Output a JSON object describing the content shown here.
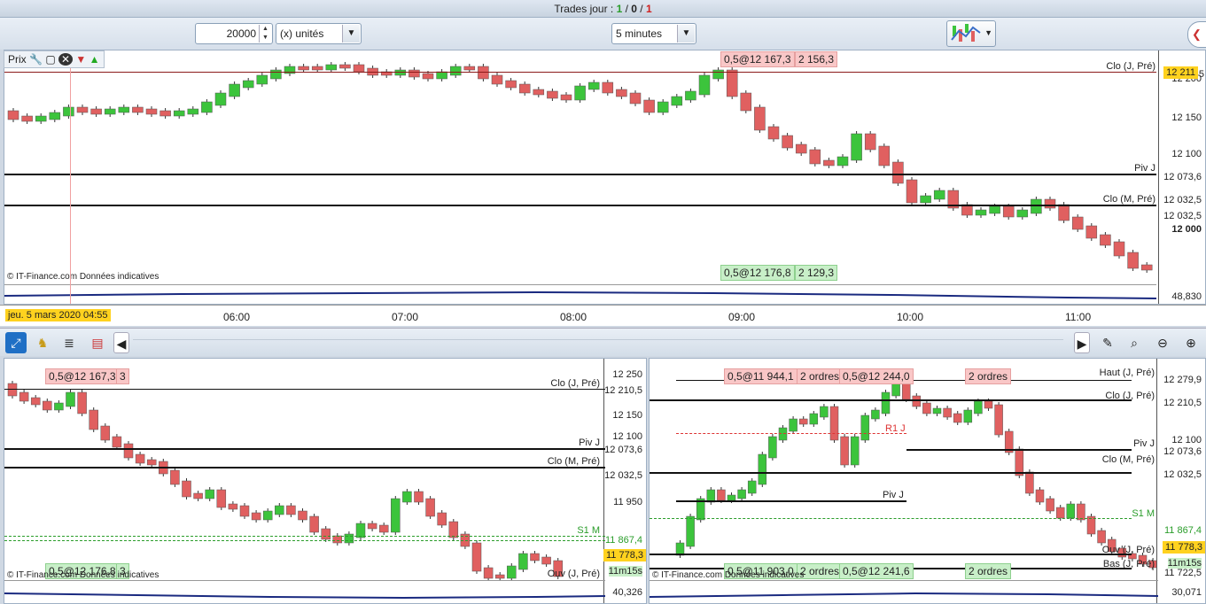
{
  "titlebar": {
    "prefix": "Trades jour : ",
    "win": "1",
    "sep1": " / ",
    "neutral": "0",
    "sep2": " / ",
    "loss": "1"
  },
  "toolbar": {
    "quantity": "20000",
    "units": "(x) unités",
    "timeframe": "5 minutes"
  },
  "main": {
    "indicator": "Prix",
    "copyright": "© IT-Finance.com  Données indicatives",
    "order_top": "0,5@12 167,3",
    "order_top2": "2 156,3",
    "order_bottom": "0,5@12 176,8",
    "order_bottom2": "2 129,3",
    "line_labels": {
      "clo_j": "Clo (J, Pré)",
      "piv_j": "Piv J",
      "clo_m": "Clo (M, Pré)"
    },
    "axis_ticks": [
      "12 200",
      "12 150",
      "12 100",
      "12 073,6",
      "12 032,5",
      "12 032,5",
      "12 000"
    ],
    "price_tag": "12 211",
    "price_tag_suffix": "5",
    "sub_value": "48,830",
    "date": "jeu. 5 mars 2020 04:55",
    "times": [
      "06:00",
      "07:00",
      "08:00",
      "09:00",
      "10:00",
      "11:00"
    ]
  },
  "left": {
    "copyright": "© IT-Finance.com  Données indicatives",
    "order_top": "0,5@12 167,3",
    "order_top2": "3",
    "order_bottom": "0,5@12 176,8",
    "order_bottom2": "3",
    "labels": {
      "clo_j": "Clo (J, Pré)",
      "piv_j": "Piv J",
      "clo_m": "Clo (M, Pré)",
      "s1": "S1 M",
      "ouv": "Ouv (J, Pré)"
    },
    "axis_ticks": [
      "12 250",
      "12 210,5",
      "12 150",
      "12 100",
      "12 073,6",
      "12 032,5",
      "11 950",
      "11 867,4"
    ],
    "price_tag": "11 778,3",
    "timer": "11m15s",
    "sub_value": "40,326"
  },
  "right": {
    "copyright": "© IT-Finance.com  Données indicatives",
    "orders_top": [
      "0,5@11 944,1",
      "2 ordres",
      "0,5@12 244,0",
      "2 ordres"
    ],
    "orders_bottom": [
      "0,5@11 903,0",
      "2 ordres",
      "0,5@12 241,6",
      "2 ordres"
    ],
    "labels": {
      "haut": "Haut (J, Pré)",
      "clo_j": "Clo (J, Pré)",
      "r1": "R1 J",
      "piv_j": "Piv J",
      "clo_m": "Clo (M, Pré)",
      "piv_j2": "Piv J",
      "s1": "S1 M",
      "ouv": "Ouv (J, Pré)",
      "bas": "Bas (J, Pré)"
    },
    "axis_ticks": [
      "12 279,9",
      "12 210,5",
      "12 100",
      "12 073,6",
      "12 032,5",
      "11 867,4",
      "11 722,5"
    ],
    "price_tag": "11 778,3",
    "timer": "11m15s",
    "sub_value": "30,071"
  },
  "colors": {
    "bull": "#3cc43c",
    "bear": "#e06060",
    "accent": "#ffd21f"
  }
}
